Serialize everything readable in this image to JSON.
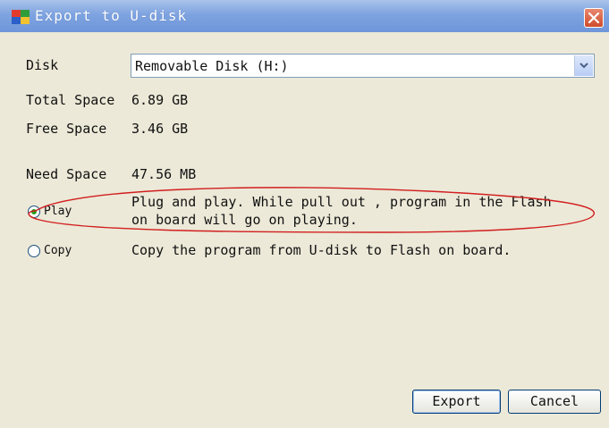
{
  "window": {
    "title": "Export to U-disk"
  },
  "fields": {
    "disk_label": "Disk",
    "disk_value": "Removable Disk (H:)",
    "total_label": "Total Space",
    "total_value": "6.89 GB",
    "free_label": "Free Space",
    "free_value": "3.46 GB",
    "need_label": "Need Space",
    "need_value": "47.56 MB"
  },
  "modes": {
    "play": {
      "label": "Play",
      "selected": true,
      "desc_line1": "Plug and play. While pull out , program in the Flash",
      "desc_line2": "on board will go on playing."
    },
    "copy": {
      "label": "Copy",
      "selected": false,
      "desc_line1": "Copy the program from U-disk to Flash on board."
    }
  },
  "buttons": {
    "export": "Export",
    "cancel": "Cancel"
  },
  "icons": {
    "app": "app-icon",
    "close": "close-icon",
    "dropdown": "chevron-down-icon"
  },
  "colors": {
    "annotation": "#d21e1e",
    "radio_dot": "#21a121",
    "title_bar": "#7ea3e0"
  }
}
